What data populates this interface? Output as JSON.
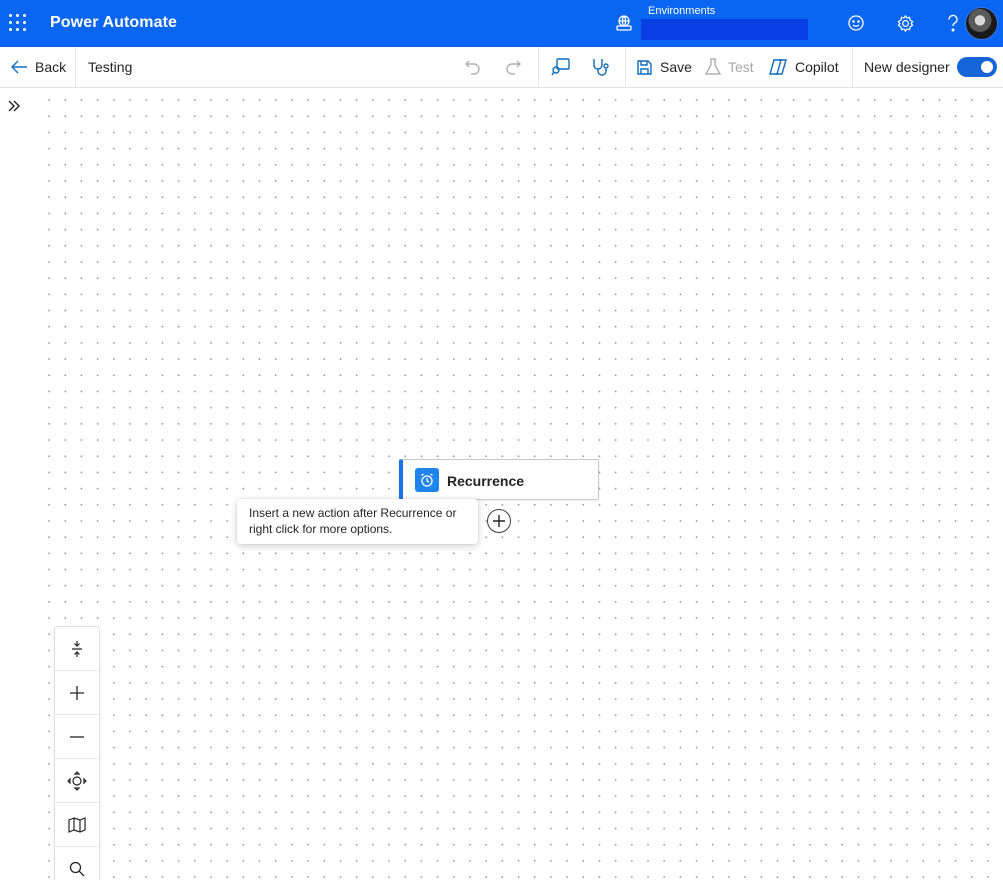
{
  "header": {
    "app_title": "Power Automate",
    "environments_label": "Environments",
    "environment_value": "",
    "icons": [
      "waffle-icon",
      "environment-icon",
      "feedback-icon",
      "gear-icon",
      "help-icon",
      "avatar"
    ]
  },
  "commandbar": {
    "back_label": "Back",
    "flow_name": "Testing",
    "save_label": "Save",
    "test_label": "Test",
    "copilot_label": "Copilot",
    "new_designer_label": "New designer",
    "new_designer_on": true
  },
  "canvas": {
    "trigger": {
      "title": "Recurrence",
      "icon": "alarm-clock-icon"
    },
    "tooltip_lines": [
      "Insert a new action after Recurrence or",
      "right click for more options."
    ]
  },
  "zoom_controls": [
    "fit-to-screen",
    "zoom-in",
    "zoom-out",
    "center",
    "minimap",
    "search"
  ],
  "colors": {
    "brand": "#0a66f0",
    "accent": "#1a73e8",
    "toggle": "#1565d8"
  }
}
